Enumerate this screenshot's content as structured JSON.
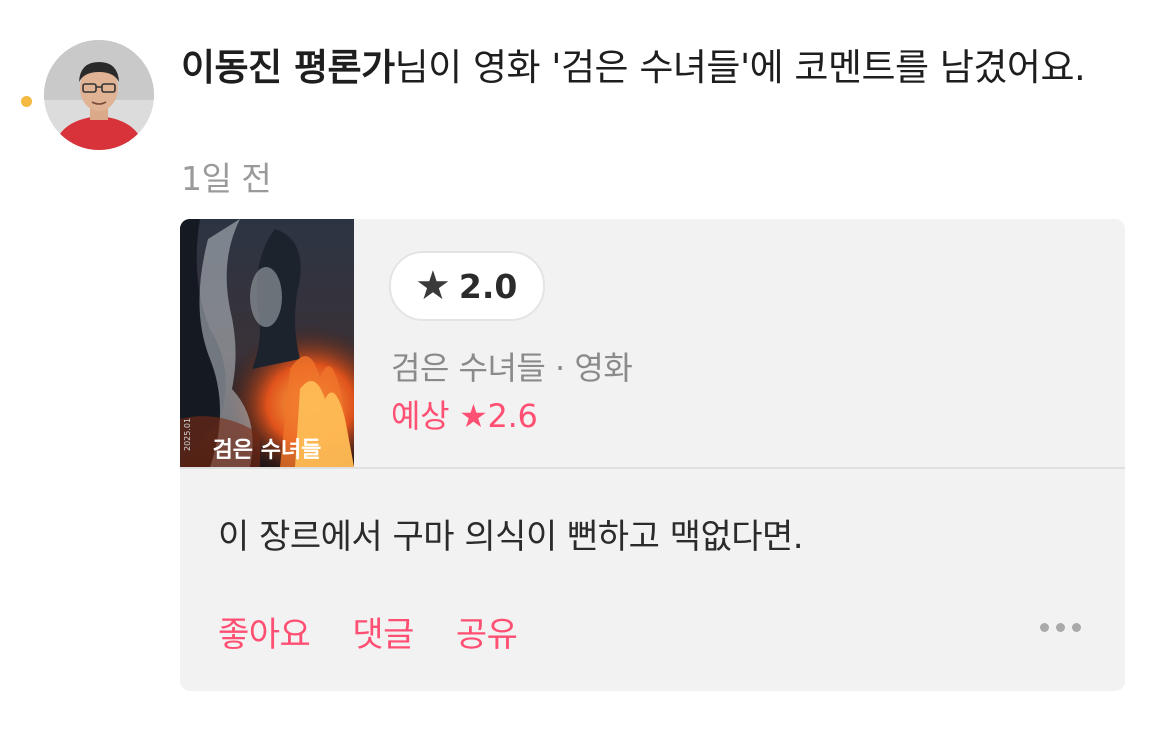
{
  "feed_item": {
    "user_name": "이동진 평론가",
    "action_text": "님이 영화 '검은 수녀들'에 코멘트를 남겼어요.",
    "time_ago": "1일 전",
    "unread": true,
    "avatar_icon": "critic-profile-photo"
  },
  "card": {
    "poster_title": "검은 수녀들",
    "poster_tagline": "2025.01",
    "rating_star_icon": "star-icon",
    "rating": "2.0",
    "movie_title": "검은 수녀들",
    "separator": "·",
    "content_type": "영화",
    "expected_label": "예상",
    "expected_star": "★",
    "expected_rating": "2.6",
    "comment_text": "이 장르에서 구마 의식이 뻔하고 맥없다면."
  },
  "actions": {
    "like_label": "좋아요",
    "comment_label": "댓글",
    "share_label": "공유",
    "more_icon": "more-horizontal-icon"
  },
  "colors": {
    "accent": "#ff4f72",
    "unread_dot": "#f5b942",
    "card_bg": "#f2f2f2"
  }
}
